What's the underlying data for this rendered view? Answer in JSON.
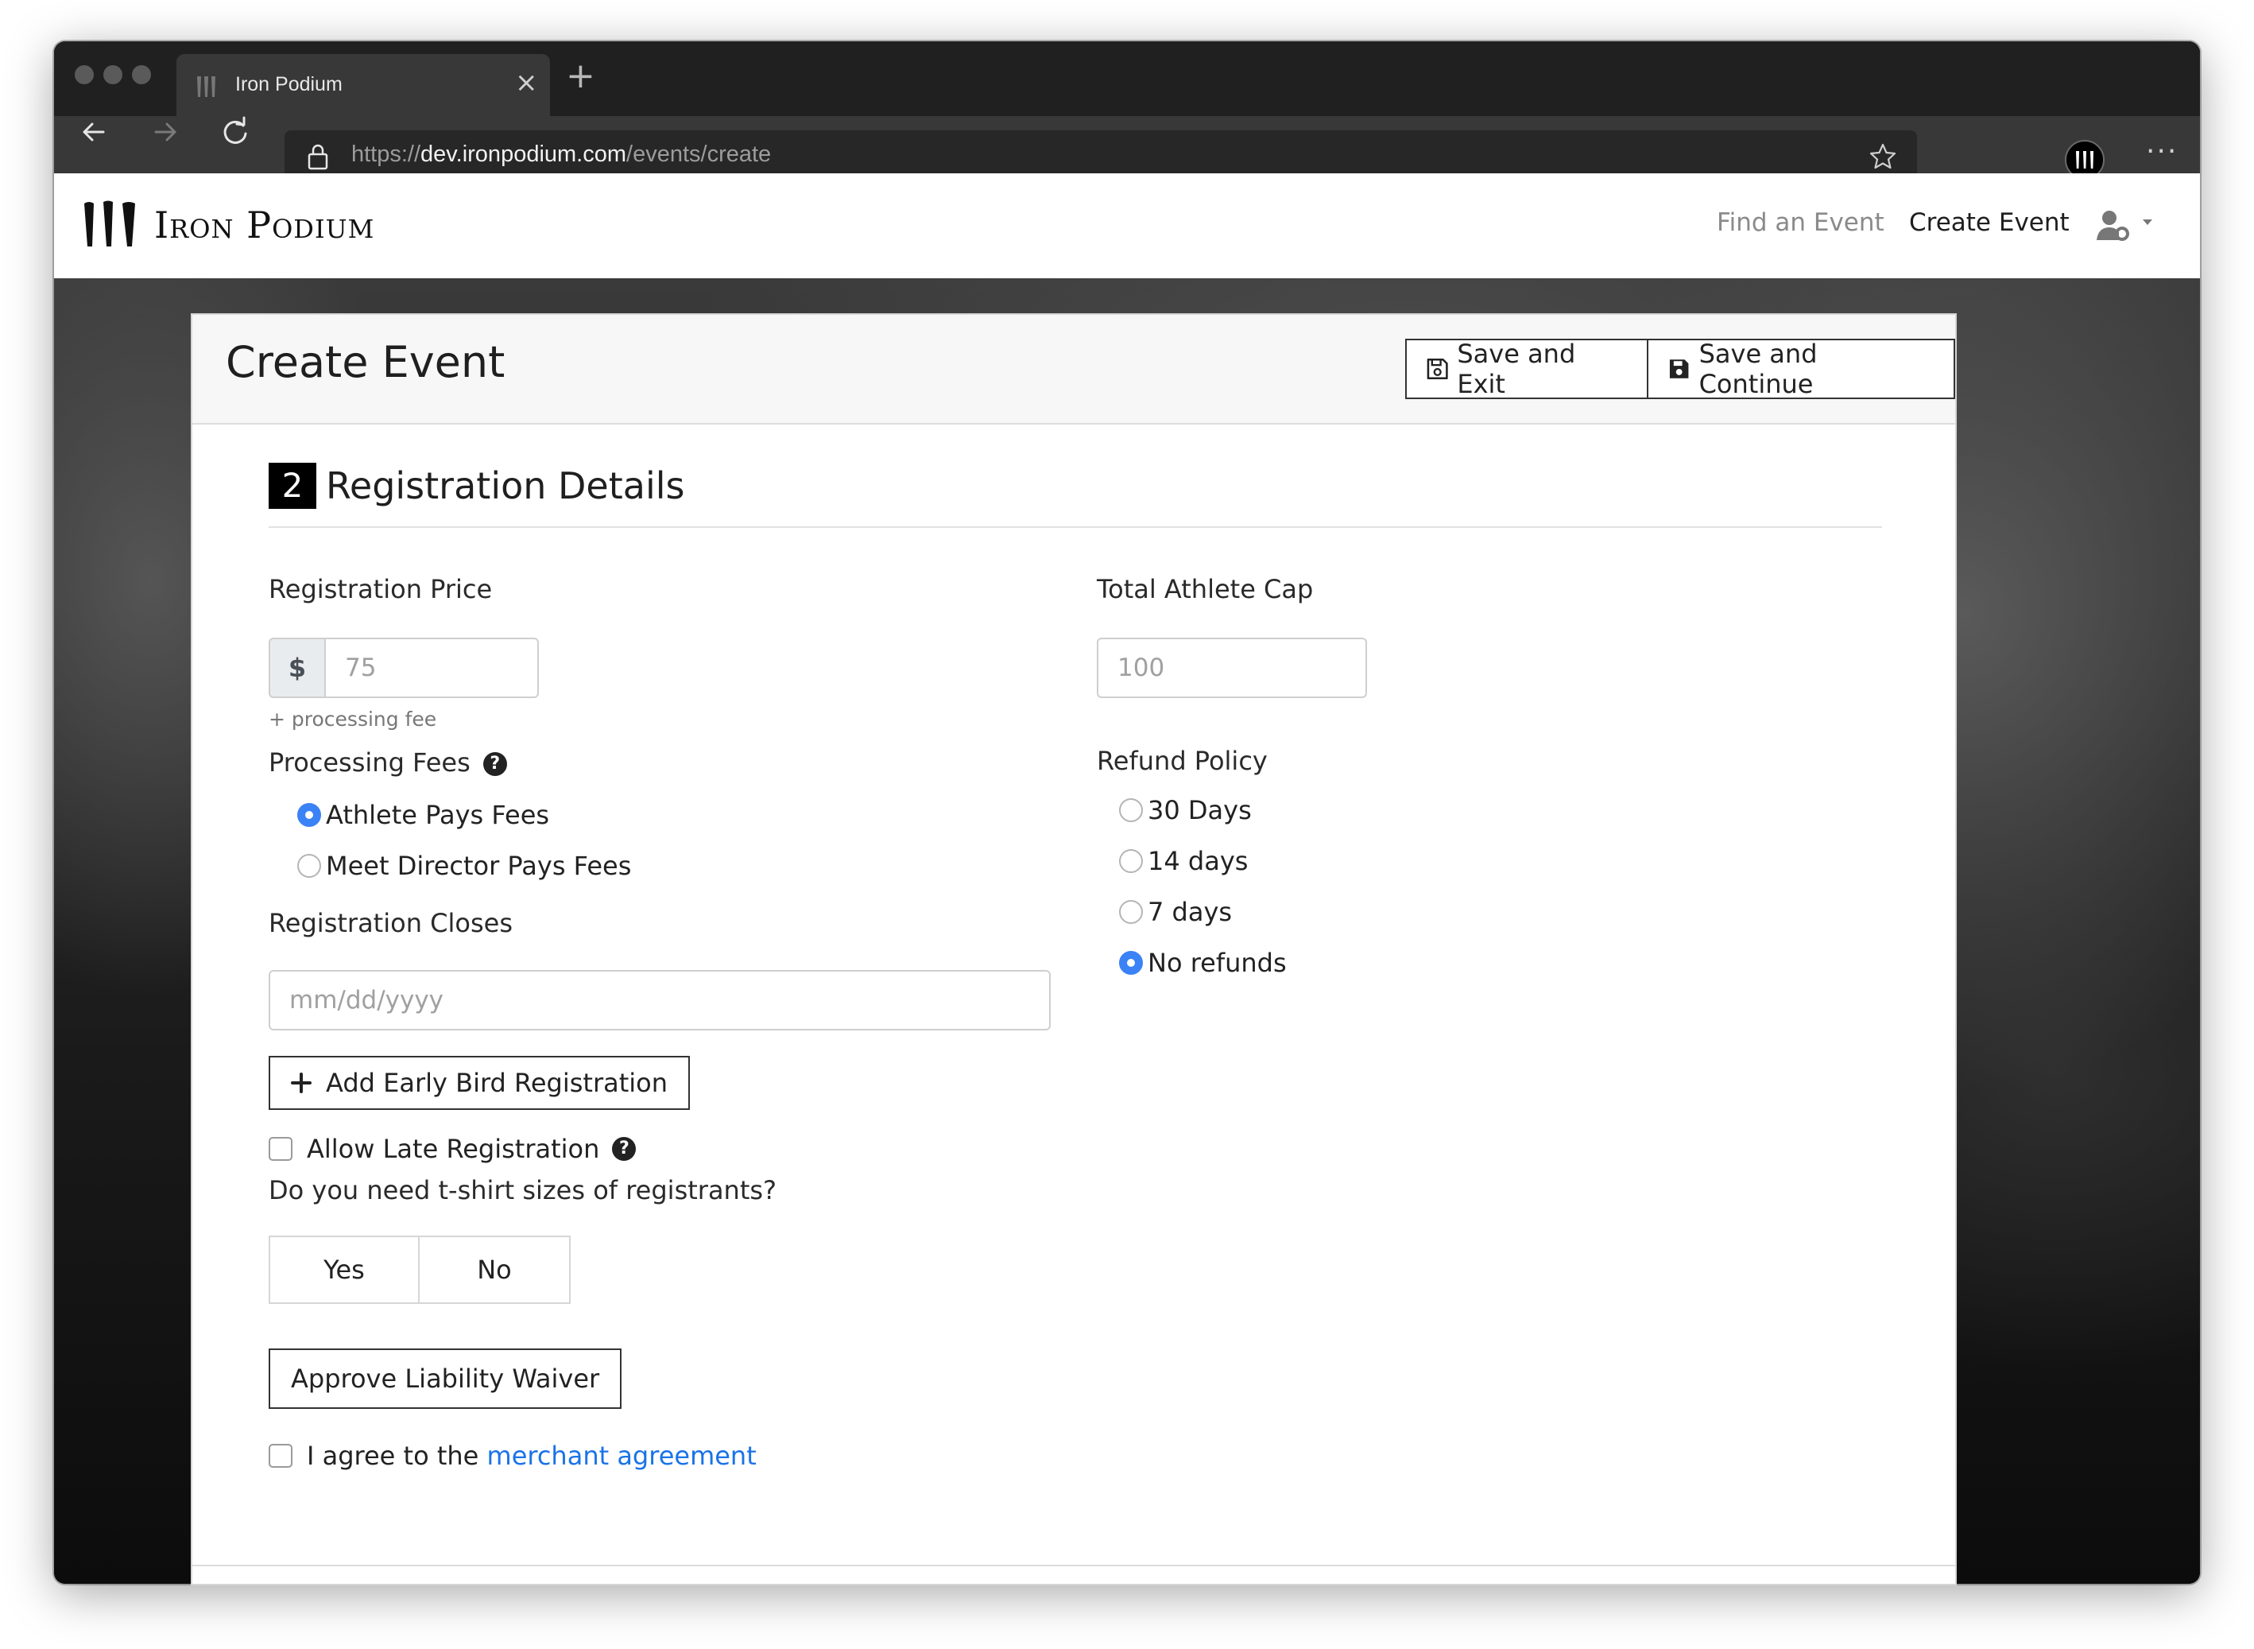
{
  "browser": {
    "tab_title": "Iron Podium",
    "tab_close": "×",
    "new_tab": "+",
    "url_scheme": "https://",
    "url_host": "dev.ironpodium.com",
    "url_path": "/events/create",
    "more_label": "···"
  },
  "site": {
    "brand": "Iron Podium",
    "nav": {
      "find_event": "Find an Event",
      "create_event": "Create Event"
    }
  },
  "card": {
    "title": "Create Event",
    "save_exit": "Save and Exit",
    "save_continue": "Save and Continue"
  },
  "section": {
    "number": "2",
    "title": "Registration Details"
  },
  "form": {
    "registration_price": {
      "label": "Registration Price",
      "currency": "$",
      "placeholder": "75",
      "help": "+ processing fee"
    },
    "athlete_cap": {
      "label": "Total Athlete Cap",
      "placeholder": "100"
    },
    "processing_fees": {
      "label": "Processing Fees",
      "help_icon": "?",
      "options": [
        {
          "label": "Athlete Pays Fees",
          "checked": true
        },
        {
          "label": "Meet Director Pays Fees",
          "checked": false
        }
      ]
    },
    "refund_policy": {
      "label": "Refund Policy",
      "options": [
        {
          "label": "30 Days",
          "checked": false
        },
        {
          "label": "14 days",
          "checked": false
        },
        {
          "label": "7 days",
          "checked": false
        },
        {
          "label": "No refunds",
          "checked": true
        }
      ]
    },
    "registration_closes": {
      "label": "Registration Closes",
      "placeholder": "mm/dd/yyyy"
    },
    "early_bird_button": "Add Early Bird Registration",
    "late_registration": {
      "label": "Allow Late Registration",
      "checked": false,
      "help_icon": "?"
    },
    "tshirt": {
      "question": "Do you need t-shirt sizes of registrants?",
      "yes": "Yes",
      "no": "No"
    },
    "waiver_button": "Approve Liability Waiver",
    "merchant": {
      "prefix": "I agree to the",
      "link": "merchant agreement",
      "checked": false
    }
  },
  "colors": {
    "accent": "#3b82f6",
    "link": "#1a73e8",
    "chrome_dark": "#202020",
    "chrome_toolbar": "#383838"
  },
  "icons": [
    "back-arrow-icon",
    "forward-arrow-icon",
    "reload-icon",
    "lock-icon",
    "star-icon",
    "user-cog-icon",
    "caret-down-icon",
    "save-outline-icon",
    "save-icon",
    "plus-icon",
    "question-circle-icon"
  ]
}
